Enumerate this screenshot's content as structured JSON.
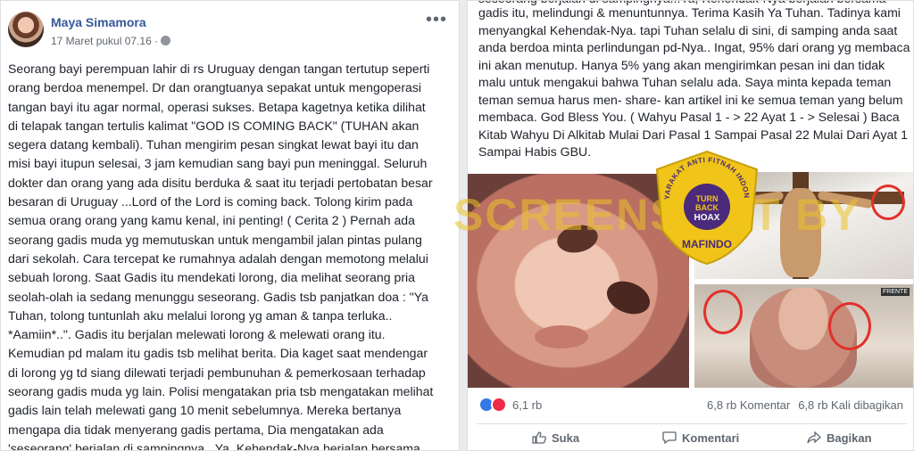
{
  "left_post": {
    "author": "Maya Simamora",
    "timestamp": "17 Maret pukul 07.16 ·",
    "body": "Seorang bayi perempuan lahir di rs Uruguay dengan tangan tertutup seperti\norang berdoa menempel. Dr dan orangtuanya sepakat untuk mengoperasi\ntangan bayi itu agar normal, operasi sukses. Betapa kagetnya ketika dilihat\ndi telapak tangan tertulis kalimat \"GOD IS COMING BACK\" (TUHAN akan\nsegera datang kembali). Tuhan mengirim pesan singkat lewat bayi itu dan\nmisi bayi itupun selesai, 3 jam kemudian sang bayi pun meninggal. Seluruh\ndokter dan orang yang ada disitu berduka & saat itu terjadi pertobatan besar\nbesaran di Uruguay ...Lord of the Lord is coming back. Tolong kirim pada\nsemua orang orang yang kamu kenal, ini penting! ( Cerita 2 ) Pernah ada\nseorang gadis muda yg memutuskan untuk mengambil jalan pintas pulang\ndari sekolah. Cara tercepat ke rumahnya adalah dengan memotong melalui\nsebuah lorong. Saat Gadis itu mendekati lorong, dia melihat seorang pria\nseolah-olah ia sedang menunggu seseorang. Gadis tsb panjatkan doa : \"Ya\nTuhan, tolong tuntunlah aku melalui lorong yg aman & tanpa terluka..\n*Aamiin*..\". Gadis itu berjalan melewati lorong & melewati orang itu.\nKemudian pd malam itu gadis tsb melihat berita. Dia kaget saat mendengar\ndi lorong yg td siang dilewati terjadi pembunuhan & pemerkosaan terhadap\nseorang gadis muda yg lain. Polisi mengatakan pria tsb mengatakan melihat\ngadis lain telah melewati gang 10 menit sebelumnya. Mereka bertanya\nmengapa dia tidak menyerang gadis pertama, Dia mengatakan ada\n'seseorang' berjalan di sampingnya...Ya, Kehendak-Nya berjalan bersama"
  },
  "right_post": {
    "cut_line": "seseorang berjalan di sampingnya...Ya, Kehendak-Nya berjalan bersama",
    "body": "gadis itu, melindungi & menuntunnya. Terima Kasih Ya Tuhan. Tadinya kami menyangkal Kehendak-Nya. tapi Tuhan selalu di sini, di samping anda saat anda berdoa minta perlindungan pd-Nya.. Ingat, 95% dari orang yg membaca ini akan menutup. Hanya 5% yang akan mengirimkan pesan ini dan tidak malu untuk mengakui bahwa Tuhan selalu ada. Saya minta kepada teman teman semua harus men- share- kan artikel ini ke semua teman yang belum membaca. God Bless You. ( Wahyu Pasal 1 - > 22 Ayat 1 - > Selesai ) Baca Kitab Wahyu Di Alkitab Mulai Dari Pasal 1 Sampai Pasal 22 Mulai Dari Ayat 1 Sampai Habis GBU.",
    "image_tag": "FRENTE",
    "reactions_count": "6,1 rb",
    "comments_count": "6,8 rb Komentar",
    "shares_count": "6,8 rb Kali dibagikan",
    "actions": {
      "like": "Suka",
      "comment": "Komentari",
      "share": "Bagikan"
    }
  },
  "watermark": "SCREENSHOT BY",
  "badge": {
    "arc_text": "MASYARAKAT ANTI FITNAH INDONESIA",
    "line1": "TURN",
    "line2": "BACK",
    "line3": "HOAX",
    "bottom": "MAFINDO"
  },
  "colors": {
    "link_blue": "#365899",
    "watermark": "#ebc328",
    "badge_gold": "#f0c419",
    "badge_purple": "#4b2a7b",
    "annotation_red": "#e3302a"
  }
}
